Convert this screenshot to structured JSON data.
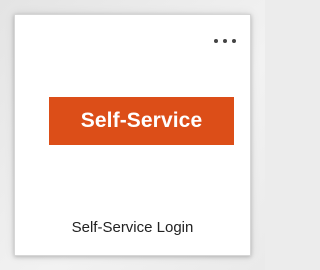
{
  "tile": {
    "logo_text": "Self-Service",
    "title": "Self-Service Login",
    "menu_icon": "more-horizontal-icon"
  },
  "colors": {
    "brand": "#dc4e18",
    "tile_background": "#ffffff",
    "text": "#222222",
    "page_background": "#ececec"
  }
}
